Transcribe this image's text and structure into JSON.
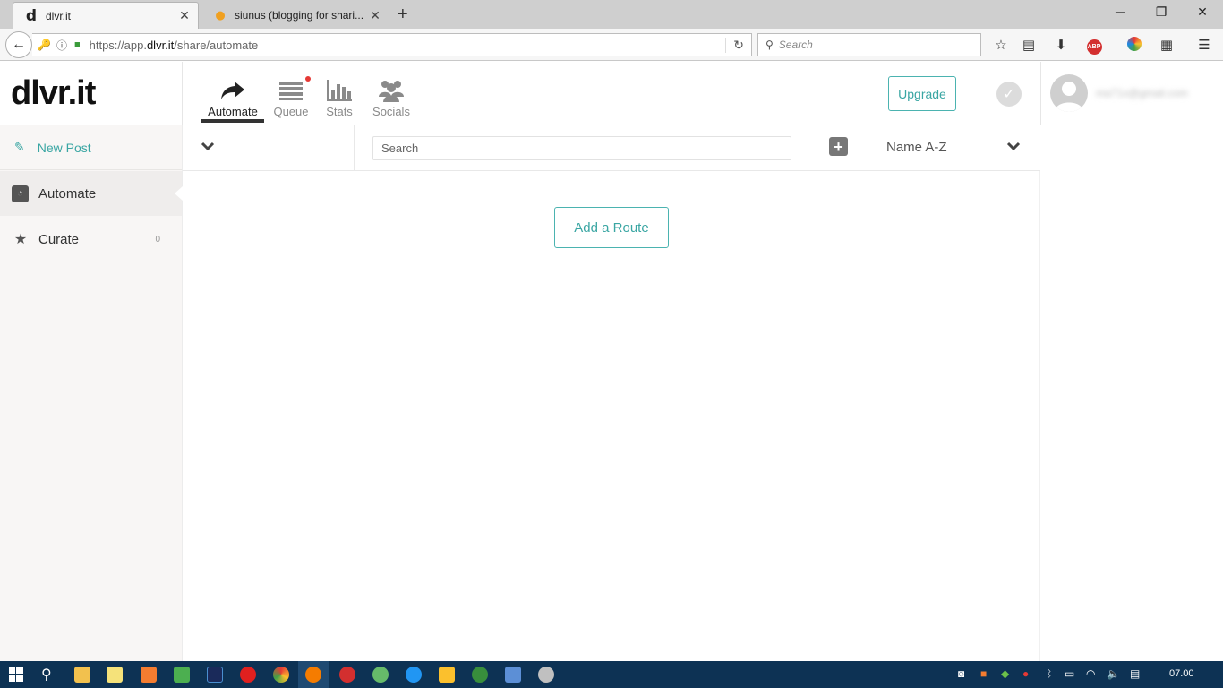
{
  "browser": {
    "tabs": [
      {
        "title": "dlvr.it",
        "favicon": "d"
      },
      {
        "title": "siunus (blogging for shari..."
      }
    ],
    "url_prefix": "https://app.",
    "url_domain": "dlvr.it",
    "url_path": "/share/automate",
    "search_placeholder": "Search"
  },
  "app": {
    "logo": "dlvr.it",
    "nav": [
      {
        "label": "Automate",
        "icon": "share-arrow-icon",
        "active": true
      },
      {
        "label": "Queue",
        "icon": "list-icon",
        "badge": true
      },
      {
        "label": "Stats",
        "icon": "bar-chart-icon"
      },
      {
        "label": "Socials",
        "icon": "group-icon"
      }
    ],
    "upgrade_label": "Upgrade",
    "user_email": "ma71x@gmail.com"
  },
  "sidebar": {
    "new_post_label": "New Post",
    "items": [
      {
        "label": "Automate",
        "icon": "rss-icon",
        "active": true
      },
      {
        "label": "Curate",
        "icon": "star-icon",
        "count": "0"
      }
    ]
  },
  "toolbar": {
    "search_placeholder": "Search",
    "sort_label": "Name A-Z"
  },
  "main": {
    "add_route_label": "Add a Route"
  },
  "taskbar": {
    "clock": "07.00"
  },
  "colors": {
    "accent": "#3aa6a3",
    "taskbar": "#0d3254"
  }
}
